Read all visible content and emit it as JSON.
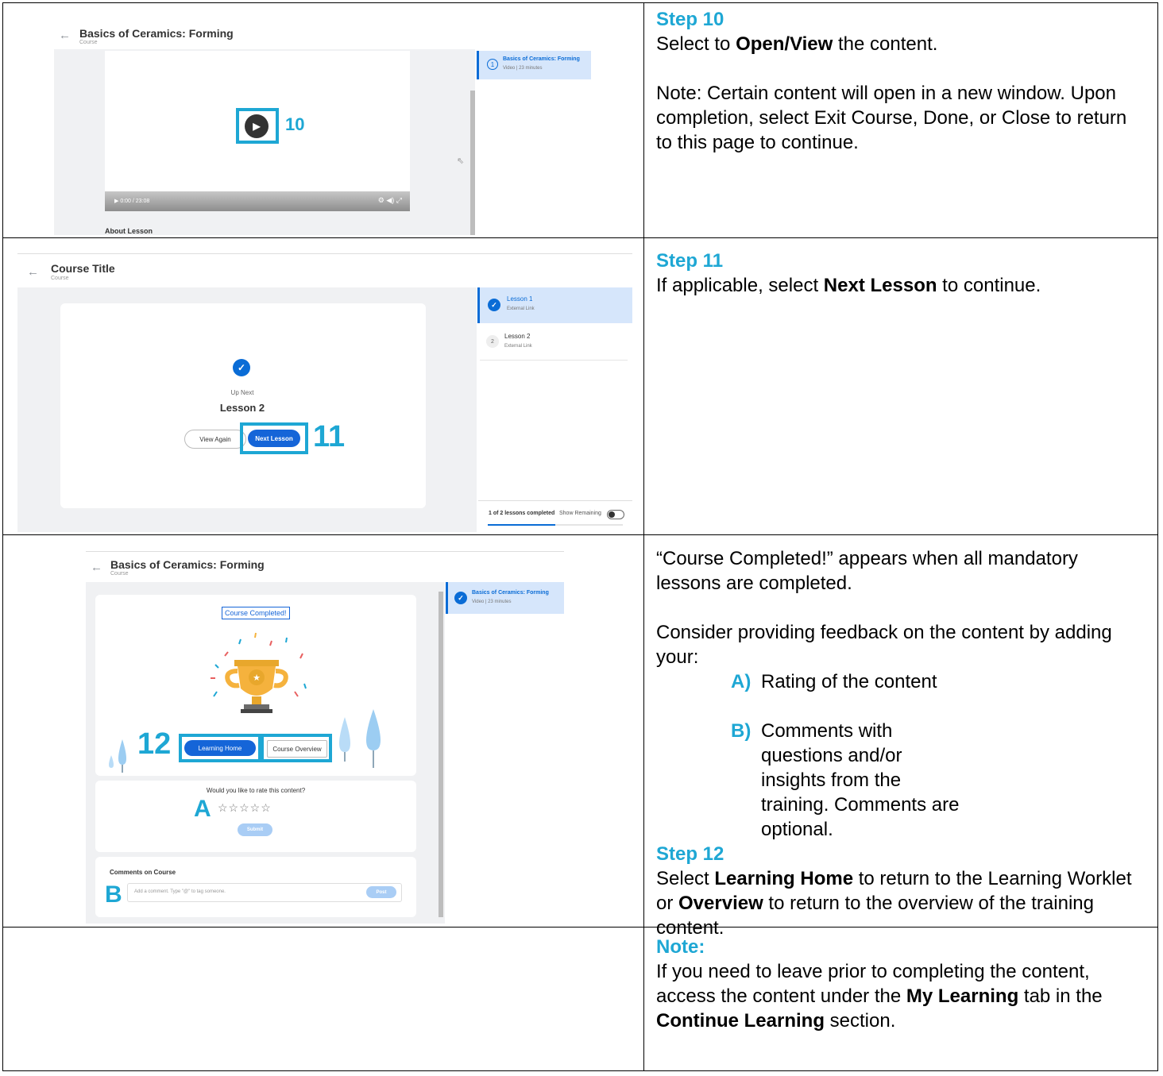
{
  "steps": {
    "s10": {
      "title": "Step 10",
      "line1_pre": "Select to ",
      "line1_bold": "Open/View",
      "line1_post": " the content.",
      "note": "Note: Certain content will open in a new window. Upon completion, select Exit Course, Done, or Close to return to this page to continue."
    },
    "s11": {
      "title": "Step 11",
      "line_pre": "If applicable, select ",
      "line_bold": "Next Lesson",
      "line_post": " to continue."
    },
    "s12": {
      "completed_text": "“Course Completed!” appears when all mandatory lessons are completed.",
      "feedback_intro": "Consider providing feedback on the content by adding your:",
      "a_label": "A)",
      "a_text": "Rating of the content",
      "b_label": "B)",
      "b_text": "Comments with questions and/or insights from the training. Comments are optional.",
      "title": "Step 12",
      "sel_pre": "Select ",
      "sel_bold1": "Learning Home",
      "sel_mid": " to return to the Learning Worklet or ",
      "sel_bold2": "Overview",
      "sel_post": " to return to the overview of the training content."
    },
    "note": {
      "title": "Note:",
      "pre": "If you need to leave prior to completing the content, access the content under the ",
      "bold1": "My Learning",
      "mid": " tab in the ",
      "bold2": "Continue Learning",
      "post": " section."
    }
  },
  "shot1": {
    "back": "←",
    "title": "Basics of Ceramics: Forming",
    "subtitle": "Course",
    "nav_num": "1",
    "nav_title": "Basics of Ceramics: Forming",
    "nav_meta": "Video  |  23 minutes",
    "time": "▶  0:00 / 23:08",
    "controls": "⚙ ◀) ⤢",
    "callout": "10",
    "about": "About Lesson"
  },
  "shot2": {
    "back": "←",
    "title": "Course Title",
    "subtitle": "Course",
    "lesson1": "Lesson 1",
    "lesson1_meta": "External Link",
    "lesson2_num": "2",
    "lesson2": "Lesson 2",
    "lesson2_meta": "External Link",
    "up_next": "Up Next",
    "next_title": "Lesson 2",
    "view_again": "View Again",
    "next_lesson": "Next Lesson",
    "callout": "11",
    "progress": "1 of 2 lessons completed",
    "show_remaining": "Show Remaining"
  },
  "shot3": {
    "back": "←",
    "title": "Basics of Ceramics: Forming",
    "subtitle": "Course",
    "nav_title": "Basics of Ceramics: Forming",
    "nav_meta": "Video  |  23 minutes",
    "completed": "Course Completed!",
    "learning_home": "Learning Home",
    "course_overview": "Course Overview",
    "callout": "12",
    "rate_q": "Would you like to rate this content?",
    "stars": "☆☆☆☆☆",
    "callout_a": "A",
    "submit": "Submit",
    "comments_title": "Comments on Course",
    "comment_placeholder": "Add a comment. Type \"@\" to tag someone.",
    "post": "Post",
    "callout_b": "B"
  },
  "colors": {
    "accent": "#1ea7d4",
    "workday_blue": "#0a6cd6"
  }
}
